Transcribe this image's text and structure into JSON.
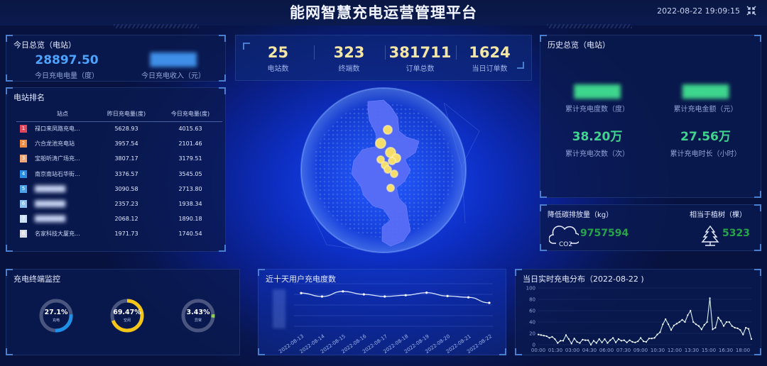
{
  "header": {
    "title": "能网智慧充电运营管理平台",
    "datetime": "2022-08-22 19:09:15",
    "fullscreen_icon": "collapse-arrows-icon"
  },
  "today_overview": {
    "title": "今日总览（电站）",
    "energy_value": "28897.50",
    "energy_label": "今日充电电量（度）",
    "income_value": "█████",
    "income_label": "今日充电收入（元）"
  },
  "kpis": [
    {
      "value": "25",
      "label": "电站数"
    },
    {
      "value": "323",
      "label": "终端数"
    },
    {
      "value": "381711",
      "label": "订单总数"
    },
    {
      "value": "1624",
      "label": "当日订单数"
    }
  ],
  "station_ranking": {
    "title": "电站排名",
    "columns": [
      "站点",
      "昨日充电量(度)",
      "今日充电量(度)"
    ],
    "rows": [
      {
        "rank": "1",
        "name": "禄口来凤路充电...",
        "yesterday": "5628.93",
        "today": "4015.63",
        "color": "#e0465c"
      },
      {
        "rank": "2",
        "name": "六合龙池充电站",
        "yesterday": "3957.54",
        "today": "2101.46",
        "color": "#ef8a45"
      },
      {
        "rank": "3",
        "name": "宝船听涛广场充...",
        "yesterday": "3807.17",
        "today": "3179.51",
        "color": "#f0a878"
      },
      {
        "rank": "4",
        "name": "南京南站石华街...",
        "yesterday": "3376.57",
        "today": "3545.05",
        "color": "#2b8ce6"
      },
      {
        "rank": "5",
        "name": "███████",
        "yesterday": "3090.58",
        "today": "2713.80",
        "color": "#4aa3ea"
      },
      {
        "rank": "6",
        "name": "███████",
        "yesterday": "2357.23",
        "today": "1938.34",
        "color": "#8cc2f0"
      },
      {
        "rank": "7",
        "name": "███████",
        "yesterday": "2068.12",
        "today": "1890.18",
        "color": "#cfe3f7"
      },
      {
        "rank": "8",
        "name": "名家科技大厦充...",
        "yesterday": "1971.73",
        "today": "1740.54",
        "color": "#d8dbe6"
      }
    ]
  },
  "history_overview": {
    "title": "历史总览（电站）",
    "items": [
      {
        "value": "█████",
        "label": "累计充电度数（度）"
      },
      {
        "value": "█████",
        "label": "累计充电金额（元）"
      },
      {
        "value": "38.20万",
        "label": "累计充电次数（次）"
      },
      {
        "value": "27.56万",
        "label": "累计充电时长（小时）"
      }
    ]
  },
  "eco": {
    "carbon_label": "降低碳排放量（kg）",
    "carbon_value": "9757594",
    "carbon_icon": "co2-cloud-icon",
    "co2_text": "CO2",
    "tree_label": "相当于植树（棵）",
    "tree_value": "5323",
    "tree_icon": "tree-icon"
  },
  "terminal_monitor": {
    "title": "充电终端监控",
    "items": [
      {
        "percent": "27.1%",
        "fraction": 0.271,
        "label": "充电",
        "color": "#1e90e8"
      },
      {
        "percent": "69.47%",
        "fraction": 0.6947,
        "label": "空闲",
        "color": "#f5c518"
      },
      {
        "percent": "3.43%",
        "fraction": 0.0343,
        "label": "异常",
        "color": "#8fd14f"
      }
    ]
  },
  "map": {
    "region_icon": "nanjing-map-icon",
    "station_points": 12
  },
  "chart_data": [
    {
      "type": "line",
      "title": "近十天用户充电度数",
      "categories": [
        "2022-08-13",
        "2022-08-14",
        "2022-08-15",
        "2022-08-16",
        "2022-08-17",
        "2022-08-18",
        "2022-08-19",
        "2022-08-20",
        "2022-08-21",
        "2022-08-22"
      ],
      "values": [
        0.78,
        0.7,
        0.82,
        0.75,
        0.7,
        0.73,
        0.79,
        0.71,
        0.68,
        0.55
      ],
      "ylim": [
        0,
        1
      ],
      "yaxis_labels_hidden": true,
      "grid": true,
      "smooth": true
    },
    {
      "type": "line",
      "title": "当日实时充电分布（2022-08-22 )",
      "x_tick_labels": [
        "00:00",
        "01:30",
        "03:00",
        "04:30",
        "06:00",
        "07:30",
        "09:00",
        "10:30",
        "12:00",
        "13:30",
        "15:00",
        "16:30",
        "18:00"
      ],
      "y_tick_labels": [
        "0",
        "20",
        "40",
        "60",
        "80",
        "100"
      ],
      "ylim": [
        0,
        100
      ],
      "grid": true,
      "values": [
        18,
        17,
        16,
        15,
        12,
        14,
        10,
        3,
        7,
        7,
        17,
        10,
        2,
        11,
        5,
        3,
        9,
        8,
        8,
        0,
        7,
        3,
        10,
        4,
        10,
        3,
        8,
        12,
        4,
        10,
        7,
        8,
        4,
        8,
        5,
        4,
        6,
        12,
        6,
        5,
        11,
        11,
        12,
        18,
        22,
        36,
        45,
        36,
        26,
        34,
        37,
        40,
        44,
        40,
        52,
        60,
        40,
        36,
        33,
        27,
        35,
        40,
        82,
        27,
        30,
        48,
        42,
        33,
        40,
        40,
        33,
        30,
        29,
        26,
        18,
        30,
        28,
        10
      ]
    }
  ]
}
